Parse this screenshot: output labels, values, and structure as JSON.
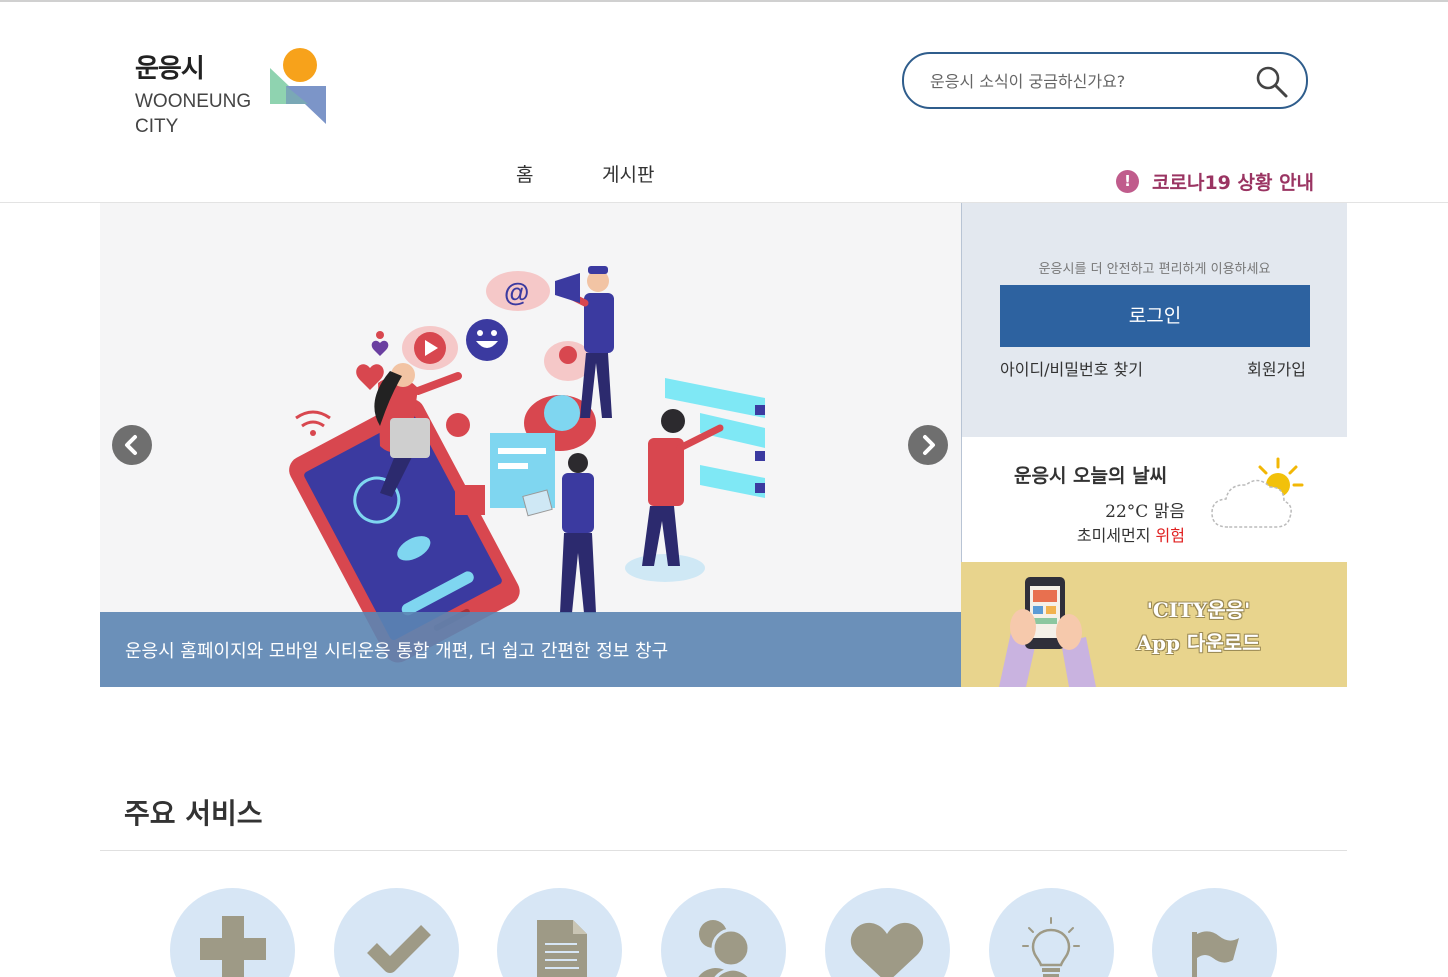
{
  "header": {
    "logo_korean": "운응시",
    "logo_english_line1": "WOONEUNG",
    "logo_english_line2": "CITY",
    "search_placeholder": "운응시 소식이 궁금하신가요?",
    "search_icon": "search-icon"
  },
  "nav": {
    "home": "홈",
    "board": "게시판",
    "covid_badge": "!",
    "covid_notice": "코로나19 상황 안내"
  },
  "banner": {
    "caption": "운응시 홈페이지와 모바일 시티운응 통합 개편, 더 쉽고 간편한 정보 창구",
    "prev_icon": "chevron-left-icon",
    "next_icon": "chevron-right-icon"
  },
  "login": {
    "message": "운응시를 더 안전하고 편리하게 이용하세요",
    "button": "로그인",
    "find_account": "아이디/비밀번호 찾기",
    "signup": "회원가입"
  },
  "weather": {
    "title": "운응시 오늘의 날씨",
    "temperature": "22°C 맑음",
    "dust_label": "초미세먼지",
    "dust_level": "위험",
    "icon": "partly-sunny-icon"
  },
  "app_banner": {
    "line1": "'CITY운응'",
    "line2": "App 다운로드"
  },
  "services": {
    "title": "주요 서비스",
    "icons": [
      "plus-icon",
      "check-icon",
      "document-icon",
      "people-icon",
      "heart-icon",
      "lightbulb-icon",
      "flag-icon"
    ]
  },
  "colors": {
    "primary": "#2d62a0",
    "search_border": "#2f5d8c",
    "covid": "#9a3462",
    "caption_bg": "#5c85b2",
    "login_bg": "#e3e8ef",
    "app_bg": "#e8d48d",
    "service_circle": "#d7e6f5",
    "service_icon": "#9e9a86",
    "danger": "#e02020"
  }
}
